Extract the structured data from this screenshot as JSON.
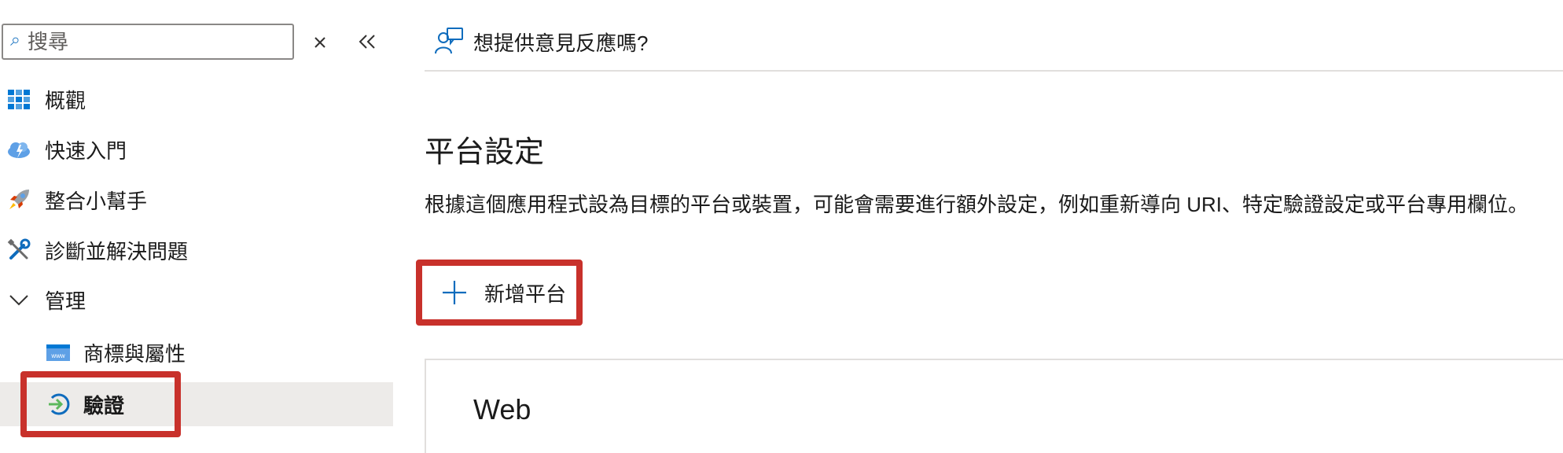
{
  "sidebar": {
    "search_placeholder": "搜尋",
    "items": [
      {
        "label": "概觀",
        "icon": "overview-grid-icon"
      },
      {
        "label": "快速入門",
        "icon": "cloud-quickstart-icon"
      },
      {
        "label": "整合小幫手",
        "icon": "rocket-icon"
      },
      {
        "label": "診斷並解決問題",
        "icon": "wrench-screwdriver-icon"
      },
      {
        "label": "管理",
        "icon": "chevron-down-icon"
      },
      {
        "label": "商標與屬性",
        "icon": "www-branding-icon"
      },
      {
        "label": "驗證",
        "icon": "authentication-arrow-icon",
        "active": true
      }
    ]
  },
  "header": {
    "feedback_label": "想提供意見反應嗎?"
  },
  "main": {
    "title": "平台設定",
    "description": "根據這個應用程式設為目標的平台或裝置，可能會需要進行額外設定，例如重新導向 URI、特定驗證設定或平台專用欄位。",
    "add_platform_label": "新增平台",
    "card_title": "Web"
  },
  "colors": {
    "highlight": "#c8312b",
    "active_bg": "#edebe9",
    "accent_blue": "#0078d4"
  }
}
